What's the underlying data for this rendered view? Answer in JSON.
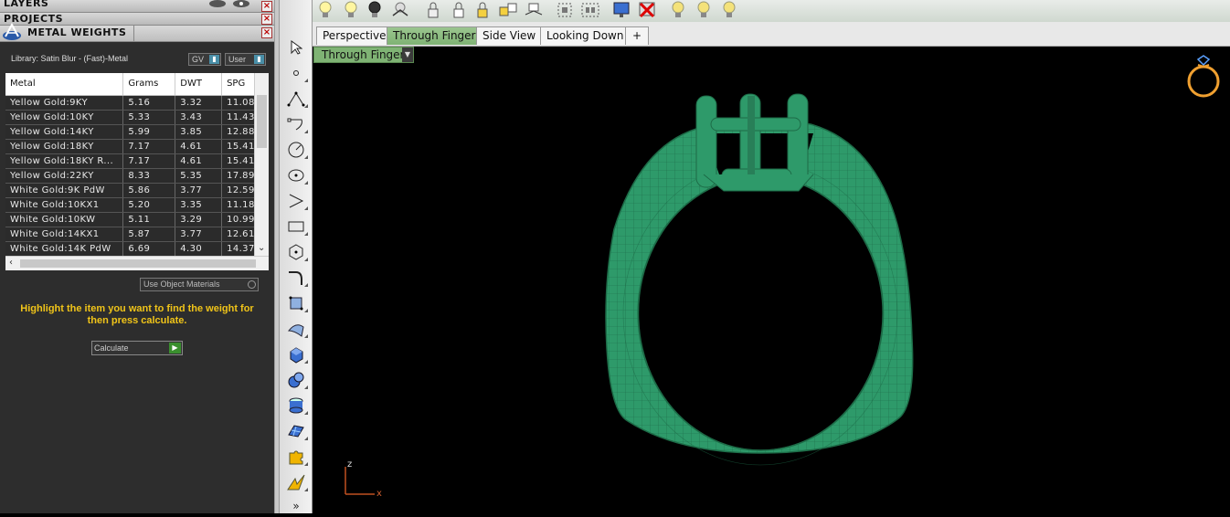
{
  "panels": {
    "layers": "LAYERS",
    "projects": "PROJECTS",
    "metal_weights": "METAL WEIGHTS"
  },
  "library": "Library: Satin Blur - (Fast)-Metal",
  "gv_select": "GV",
  "user_select": "User",
  "table": {
    "headers": [
      "Metal",
      "Grams",
      "DWT",
      "SPG"
    ],
    "rows": [
      [
        "Yellow Gold:9KY",
        "5.16",
        "3.32",
        "11.08"
      ],
      [
        "Yellow Gold:10KY",
        "5.33",
        "3.43",
        "11.43"
      ],
      [
        "Yellow Gold:14KY",
        "5.99",
        "3.85",
        "12.88"
      ],
      [
        "Yellow Gold:18KY",
        "7.17",
        "4.61",
        "15.41"
      ],
      [
        "Yellow Gold:18KY R...",
        "7.17",
        "4.61",
        "15.41"
      ],
      [
        "Yellow Gold:22KY",
        "8.33",
        "5.35",
        "17.89"
      ],
      [
        "White Gold:9K PdW",
        "5.86",
        "3.77",
        "12.59"
      ],
      [
        "White Gold:10KX1",
        "5.20",
        "3.35",
        "11.18"
      ],
      [
        "White Gold:10KW",
        "5.11",
        "3.29",
        "10.99"
      ],
      [
        "White Gold:14KX1",
        "5.87",
        "3.77",
        "12.61"
      ],
      [
        "White Gold:14K PdW",
        "6.69",
        "4.30",
        "14.37"
      ]
    ]
  },
  "use_object_materials": "Use Object Materials",
  "instruction": "Highlight the item you want to find the weight for then press calculate.",
  "calculate_button": "Calculate",
  "tabs": [
    "Perspective",
    "Through Finger",
    "Side View",
    "Looking Down",
    "+"
  ],
  "active_tab": "Through Finger",
  "viewport_label": "Through Finger",
  "axis": {
    "z": "z",
    "x": "x"
  },
  "colors": {
    "model": "#2e9a6a",
    "active_tab": "#7fb374",
    "instruction": "#f0c419"
  }
}
